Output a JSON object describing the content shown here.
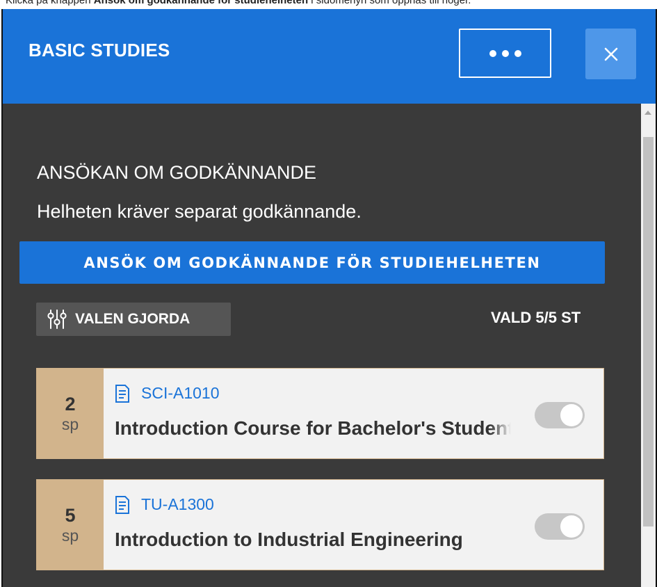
{
  "caption": {
    "prefix": "Klicka på knappen ",
    "button_name": "Ansök om godkännande för studiehelheten",
    "suffix": " i sidomenyn som öppnas till höger."
  },
  "header": {
    "title": "BASIC STUDIES",
    "more_icon": "ellipsis-icon",
    "close_icon": "close-icon",
    "background_color": "#1a73d8"
  },
  "approval": {
    "heading": "ANSÖKAN OM GODKÄNNANDE",
    "description": "Helheten kräver separat godkännande.",
    "apply_button_label": "ANSÖK OM GODKÄNNANDE FÖR STUDIEHELHETEN"
  },
  "choices": {
    "button_label": "VALEN GJORDA",
    "button_icon": "sliders-icon",
    "selected_count": "VALD 5/5 ST"
  },
  "courses": [
    {
      "credits": "2",
      "credit_unit": "sp",
      "icon": "document-icon",
      "code": "SCI-A1010",
      "name": "Introduction Course for Bachelor's Students",
      "toggle_on": false
    },
    {
      "credits": "5",
      "credit_unit": "sp",
      "icon": "document-icon",
      "code": "TU-A1300",
      "name": "Introduction to Industrial Engineering",
      "toggle_on": false
    }
  ],
  "colors": {
    "accent": "#1a73d8",
    "panel_background": "#3a3a3a",
    "credits_background": "#d2b48c",
    "card_background": "#f2f2f2"
  }
}
